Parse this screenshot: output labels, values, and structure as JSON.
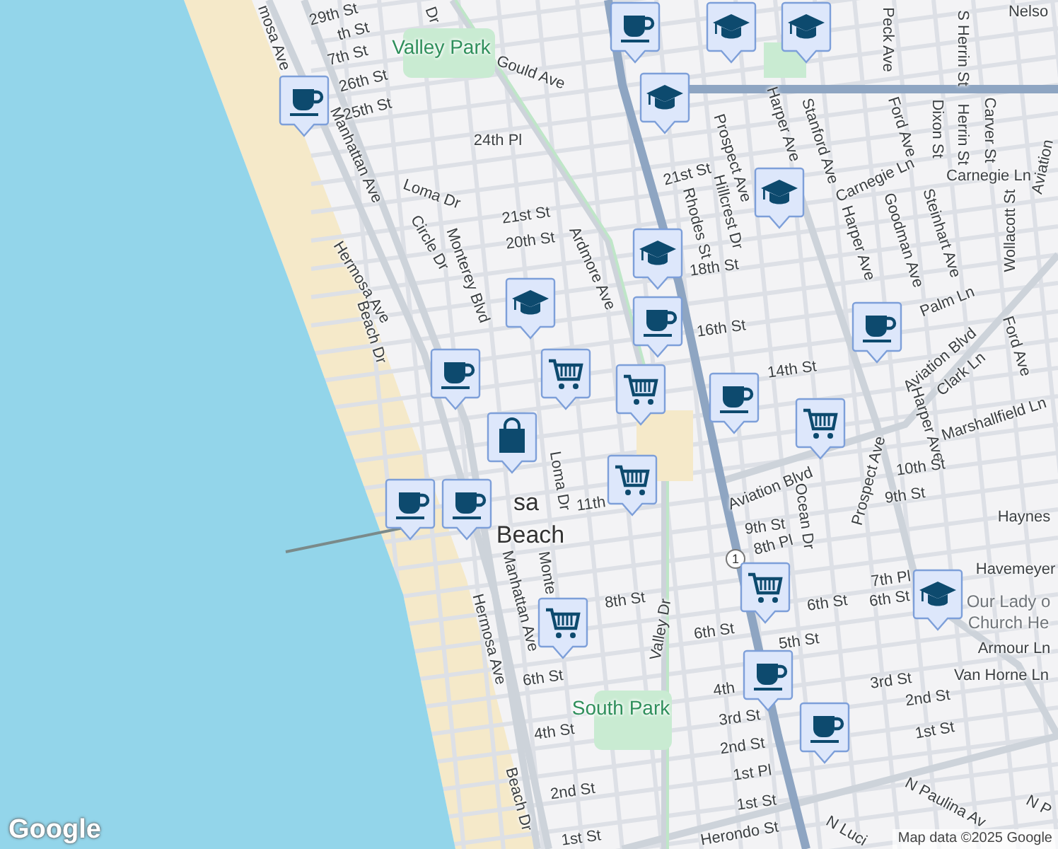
{
  "map": {
    "labels": [
      {
        "text": "mosa Ave",
        "kind": "street"
      },
      {
        "text": "29th St",
        "kind": "street"
      },
      {
        "text": "th St",
        "kind": "street"
      },
      {
        "text": "7th St",
        "kind": "street"
      },
      {
        "text": "Dr",
        "kind": "street"
      },
      {
        "text": "Valley Park",
        "kind": "park"
      },
      {
        "text": "Gould Ave",
        "kind": "street"
      },
      {
        "text": "26th St",
        "kind": "street"
      },
      {
        "text": "25th St",
        "kind": "street"
      },
      {
        "text": "24th Pl",
        "kind": "street"
      },
      {
        "text": "Manhattan Ave",
        "kind": "street"
      },
      {
        "text": "Loma Dr",
        "kind": "street"
      },
      {
        "text": "Circle Dr",
        "kind": "street"
      },
      {
        "text": "Monterey Blvd",
        "kind": "street"
      },
      {
        "text": "Hermosa Ave",
        "kind": "street"
      },
      {
        "text": "21st St",
        "kind": "street"
      },
      {
        "text": "20th St",
        "kind": "street"
      },
      {
        "text": "Ardmore Ave",
        "kind": "street"
      },
      {
        "text": "Beach Dr",
        "kind": "street"
      },
      {
        "text": "21st St",
        "kind": "street"
      },
      {
        "text": "Rhodes St",
        "kind": "street"
      },
      {
        "text": "Hillcrest Dr",
        "kind": "street"
      },
      {
        "text": "Prospect Ave",
        "kind": "street"
      },
      {
        "text": "18th St",
        "kind": "street"
      },
      {
        "text": "16th St",
        "kind": "street"
      },
      {
        "text": "14th St",
        "kind": "street"
      },
      {
        "text": "Peck Ave",
        "kind": "street"
      },
      {
        "text": "S Herrin St",
        "kind": "street"
      },
      {
        "text": "Nelso",
        "kind": "street"
      },
      {
        "text": "Harper Ave",
        "kind": "street"
      },
      {
        "text": "Stanford Ave",
        "kind": "street"
      },
      {
        "text": "Ford Ave",
        "kind": "street"
      },
      {
        "text": "Dixon St",
        "kind": "street"
      },
      {
        "text": "Herrin St",
        "kind": "street"
      },
      {
        "text": "Carver St",
        "kind": "street"
      },
      {
        "text": "Carnegie Ln",
        "kind": "street"
      },
      {
        "text": "Carnegie Ln",
        "kind": "street"
      },
      {
        "text": "Aviation",
        "kind": "street"
      },
      {
        "text": "Harper Ave",
        "kind": "street"
      },
      {
        "text": "Goodman Ave",
        "kind": "street"
      },
      {
        "text": "Steinhart Ave",
        "kind": "street"
      },
      {
        "text": "Wollacott St",
        "kind": "street"
      },
      {
        "text": "Palm Ln",
        "kind": "street"
      },
      {
        "text": "Aviation Blvd",
        "kind": "street"
      },
      {
        "text": "Clark Ln",
        "kind": "street"
      },
      {
        "text": "Ford Ave",
        "kind": "street"
      },
      {
        "text": "Marshallfield Ln",
        "kind": "street"
      },
      {
        "text": "Harper Ave",
        "kind": "street"
      },
      {
        "text": "Aviation Blvd",
        "kind": "street"
      },
      {
        "text": "10th St",
        "kind": "street"
      },
      {
        "text": "9th St",
        "kind": "street"
      },
      {
        "text": "Prospect Ave",
        "kind": "street"
      },
      {
        "text": "Ocean Dr",
        "kind": "street"
      },
      {
        "text": "9th St",
        "kind": "street"
      },
      {
        "text": "8th Pl",
        "kind": "street"
      },
      {
        "text": "Haynes",
        "kind": "street"
      },
      {
        "text": "Havemeyer",
        "kind": "street"
      },
      {
        "text": "7th Pl",
        "kind": "street"
      },
      {
        "text": "6th St",
        "kind": "street"
      },
      {
        "text": "6th St",
        "kind": "street"
      },
      {
        "text": "Our Lady o",
        "kind": "place"
      },
      {
        "text": "Church He",
        "kind": "place"
      },
      {
        "text": "Armour Ln",
        "kind": "street"
      },
      {
        "text": "Van Horne Ln",
        "kind": "street"
      },
      {
        "text": "5th St",
        "kind": "street"
      },
      {
        "text": "3rd St",
        "kind": "street"
      },
      {
        "text": "2nd St",
        "kind": "street"
      },
      {
        "text": "1st St",
        "kind": "street"
      },
      {
        "text": "6th St",
        "kind": "street"
      },
      {
        "text": "8th St",
        "kind": "street"
      },
      {
        "text": "11th",
        "kind": "street"
      },
      {
        "text": "Loma Dr",
        "kind": "street"
      },
      {
        "text": "Monte",
        "kind": "street"
      },
      {
        "text": "Manhattan Ave",
        "kind": "street"
      },
      {
        "text": "Hermosa Ave",
        "kind": "street"
      },
      {
        "text": "Valley Dr",
        "kind": "street"
      },
      {
        "text": "4th",
        "kind": "street"
      },
      {
        "text": "3rd St",
        "kind": "street"
      },
      {
        "text": "2nd St",
        "kind": "street"
      },
      {
        "text": "1st Pl",
        "kind": "street"
      },
      {
        "text": "1st St",
        "kind": "street"
      },
      {
        "text": "Herondo St",
        "kind": "street"
      },
      {
        "text": "N Luci",
        "kind": "street"
      },
      {
        "text": "N Paulina Av",
        "kind": "street"
      },
      {
        "text": "N P",
        "kind": "street"
      },
      {
        "text": "6th St",
        "kind": "street"
      },
      {
        "text": "South Park",
        "kind": "park"
      },
      {
        "text": "4th St",
        "kind": "street"
      },
      {
        "text": "2nd St",
        "kind": "street"
      },
      {
        "text": "1st St",
        "kind": "street"
      },
      {
        "text": "Beach Dr",
        "kind": "street"
      },
      {
        "text": "sa",
        "kind": "city"
      },
      {
        "text": "Beach",
        "kind": "city"
      }
    ],
    "route_shield": "1",
    "markers": [
      {
        "kind": "cup"
      },
      {
        "kind": "school"
      },
      {
        "kind": "school"
      },
      {
        "kind": "cup"
      },
      {
        "kind": "school"
      },
      {
        "kind": "school"
      },
      {
        "kind": "school"
      },
      {
        "kind": "cup"
      },
      {
        "kind": "school"
      },
      {
        "kind": "cup"
      },
      {
        "kind": "cup"
      },
      {
        "kind": "cart"
      },
      {
        "kind": "cart"
      },
      {
        "kind": "cart"
      },
      {
        "kind": "bag"
      },
      {
        "kind": "cup"
      },
      {
        "kind": "cup"
      },
      {
        "kind": "cup"
      },
      {
        "kind": "cart"
      },
      {
        "kind": "cart"
      },
      {
        "kind": "cart"
      },
      {
        "kind": "cup"
      },
      {
        "kind": "cup"
      },
      {
        "kind": "school"
      }
    ],
    "logo": "Google",
    "attribution": "Map data ©2025 Google"
  }
}
